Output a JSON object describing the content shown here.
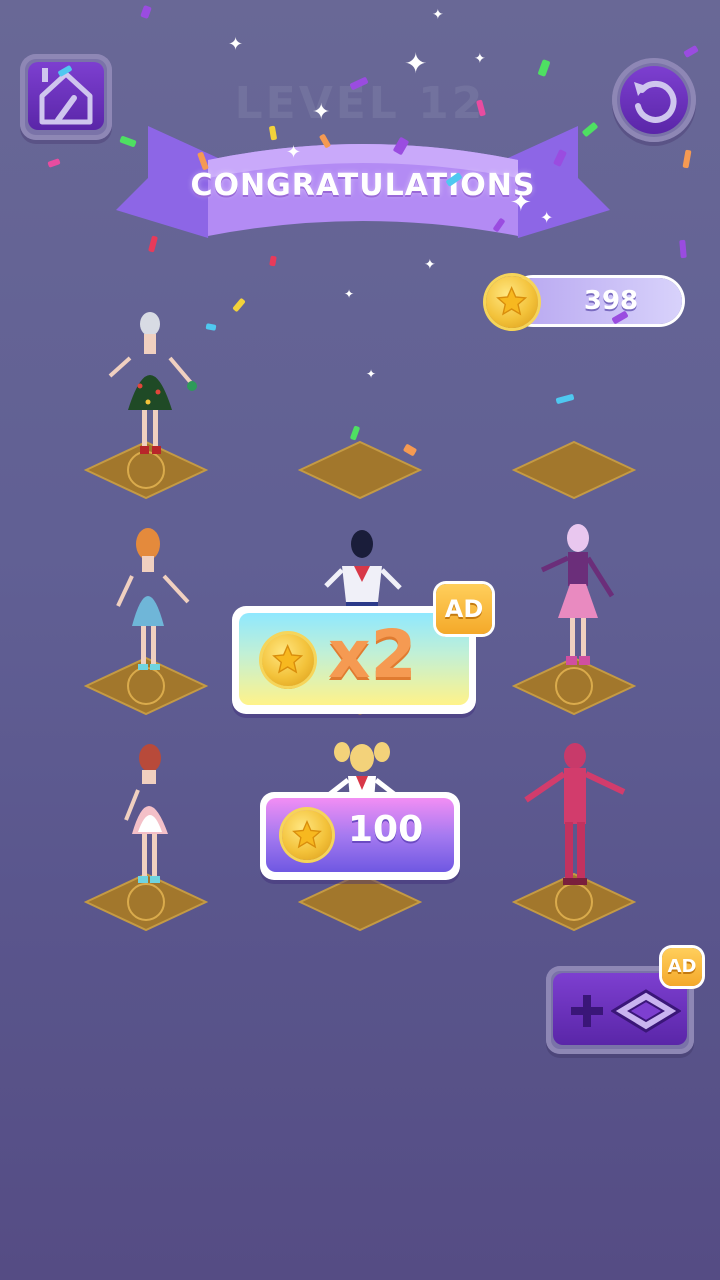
{
  "header": {
    "level_label": "LEVEL 12",
    "banner_text": "CONGRATULATIONS"
  },
  "wallet": {
    "coins": "398",
    "icon": "star-coin-icon"
  },
  "rewards": {
    "double": {
      "label": "x2",
      "badge": "AD",
      "icon": "star-coin-icon"
    },
    "claim": {
      "label": "100",
      "icon": "star-coin-icon"
    }
  },
  "add_tile": {
    "badge": "AD",
    "icon_plus": "plus-icon",
    "icon_tile": "tile-icon"
  },
  "buttons": {
    "home_icon": "home-icon",
    "restart_icon": "restart-icon"
  },
  "board": {
    "rows": 3,
    "cols": 3,
    "slots": [
      {
        "row": 1,
        "col": 1,
        "filled": true,
        "outfit": "green tree dress"
      },
      {
        "row": 1,
        "col": 2,
        "filled": false
      },
      {
        "row": 1,
        "col": 3,
        "filled": false
      },
      {
        "row": 2,
        "col": 1,
        "filled": true,
        "outfit": "blue dress"
      },
      {
        "row": 2,
        "col": 2,
        "filled": true,
        "outfit": "sailor uniform"
      },
      {
        "row": 2,
        "col": 3,
        "filled": true,
        "outfit": "pink skirt"
      },
      {
        "row": 3,
        "col": 1,
        "filled": true,
        "outfit": "pink apron dress"
      },
      {
        "row": 3,
        "col": 2,
        "filled": true,
        "outfit": "sailor outfit"
      },
      {
        "row": 3,
        "col": 3,
        "filled": true,
        "outfit": "pink tracksuit"
      }
    ]
  },
  "colors": {
    "background": "#67679a",
    "button_purple": "#5a26a8",
    "coin_gold": "#f3c23a",
    "x2_text": "#f59a52",
    "ad_badge": "#f4a92a"
  }
}
